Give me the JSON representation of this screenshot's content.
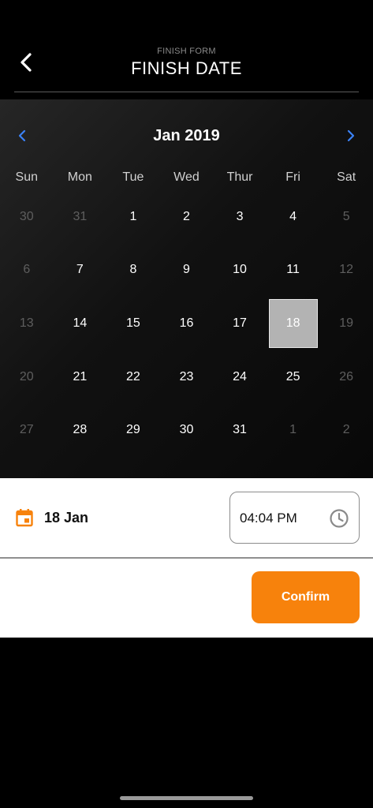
{
  "header": {
    "subtitle": "FINISH FORM",
    "title": "FINISH DATE",
    "back_icon": "chevron-left-icon"
  },
  "calendar": {
    "month_label": "Jan 2019",
    "prev_icon": "chevron-left-icon",
    "next_icon": "chevron-right-icon",
    "accent_color": "#3b82f6",
    "weekdays": [
      "Sun",
      "Mon",
      "Tue",
      "Wed",
      "Thur",
      "Fri",
      "Sat"
    ],
    "days": [
      {
        "label": "30",
        "muted": true
      },
      {
        "label": "31",
        "muted": true
      },
      {
        "label": "1"
      },
      {
        "label": "2"
      },
      {
        "label": "3"
      },
      {
        "label": "4"
      },
      {
        "label": "5",
        "muted": true
      },
      {
        "label": "6",
        "muted": true
      },
      {
        "label": "7"
      },
      {
        "label": "8"
      },
      {
        "label": "9"
      },
      {
        "label": "10"
      },
      {
        "label": "11"
      },
      {
        "label": "12",
        "muted": true
      },
      {
        "label": "13",
        "muted": true
      },
      {
        "label": "14"
      },
      {
        "label": "15"
      },
      {
        "label": "16"
      },
      {
        "label": "17"
      },
      {
        "label": "18",
        "selected": true
      },
      {
        "label": "19",
        "muted": true
      },
      {
        "label": "20",
        "muted": true
      },
      {
        "label": "21"
      },
      {
        "label": "22"
      },
      {
        "label": "23"
      },
      {
        "label": "24"
      },
      {
        "label": "25"
      },
      {
        "label": "26",
        "muted": true
      },
      {
        "label": "27",
        "muted": true
      },
      {
        "label": "28"
      },
      {
        "label": "29"
      },
      {
        "label": "30"
      },
      {
        "label": "31"
      },
      {
        "label": "1",
        "muted": true
      },
      {
        "label": "2",
        "muted": true
      }
    ]
  },
  "selection": {
    "date_icon": "calendar-icon",
    "date_label": "18 Jan",
    "time_value": "04:04 PM",
    "clock_icon": "clock-icon",
    "icon_color": "#f7820c"
  },
  "actions": {
    "confirm_label": "Confirm",
    "confirm_color": "#f7820c"
  }
}
